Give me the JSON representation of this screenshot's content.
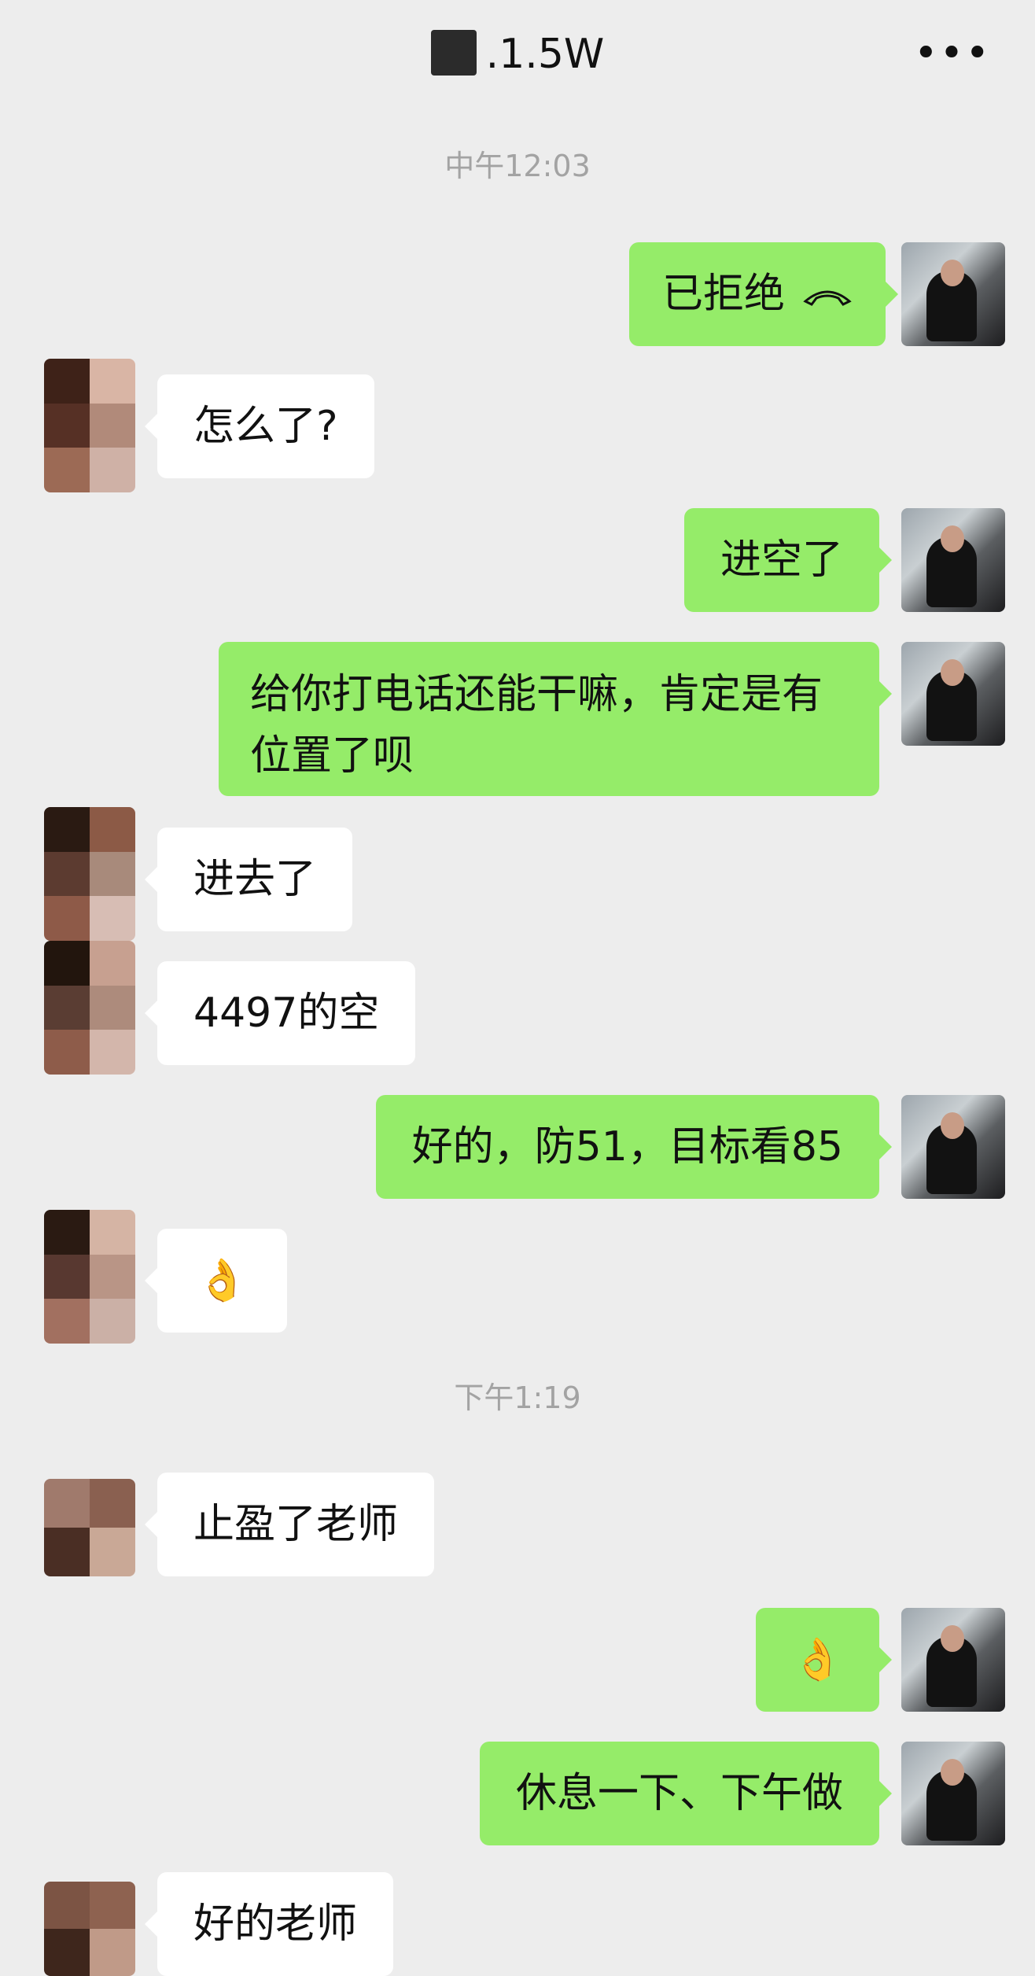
{
  "header": {
    "title": ".1.5W",
    "more": "•••"
  },
  "timestamps": [
    "中午12:03",
    "下午1:19"
  ],
  "messages": [
    {
      "side": "right",
      "text": "已拒绝",
      "icon": "hangup-phone-icon"
    },
    {
      "side": "left",
      "text": "怎么了?"
    },
    {
      "side": "right",
      "text": "进空了"
    },
    {
      "side": "right",
      "text": "给你打电话还能干嘛，肯定是有位置了呗"
    },
    {
      "side": "left",
      "text": "进去了"
    },
    {
      "side": "left",
      "text": "4497的空"
    },
    {
      "side": "right",
      "text": "好的，防51，目标看85"
    },
    {
      "side": "left",
      "text": "👌"
    },
    {
      "side": "left",
      "text": "止盈了老师"
    },
    {
      "side": "right",
      "text": "👌"
    },
    {
      "side": "right",
      "text": "休息一下、下午做"
    },
    {
      "side": "left",
      "text": "好的老师"
    }
  ],
  "colors": {
    "background": "#ededed",
    "bubble_right": "#95ec69",
    "bubble_left": "#ffffff",
    "time_text": "#a3a3a3"
  }
}
